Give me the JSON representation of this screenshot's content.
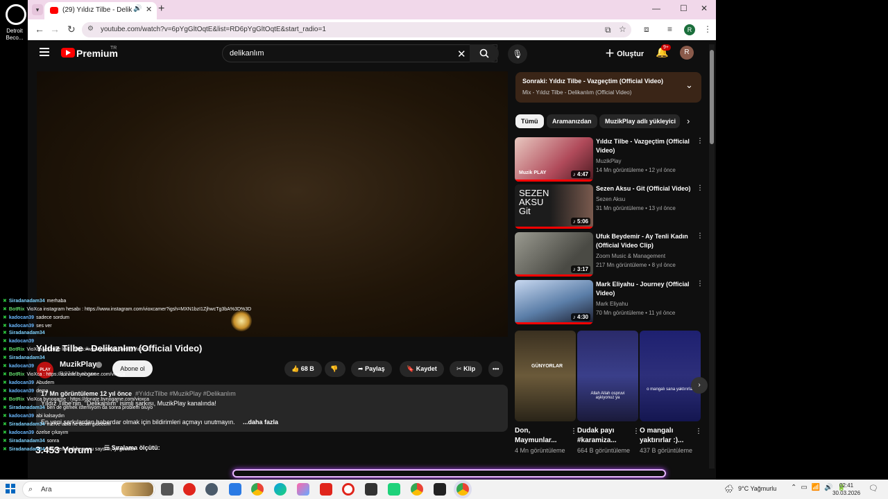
{
  "desktop": {
    "shortcut_label": "Detroit Beco..."
  },
  "browser": {
    "tab_count_title": "(29) Yıldız Tilbe - Delikanlım",
    "url": "youtube.com/watch?v=6pYgGltOqtE&list=RD6pYgGltOqtE&start_radio=1",
    "profile_initial": "R"
  },
  "yt": {
    "brand": "Premium",
    "tr": "TR",
    "search_value": "delikanlım",
    "create_label": "Oluştur",
    "notif_badge": "9+",
    "avatar_initial": "R"
  },
  "video": {
    "title": "Yıldız Tilbe - Delikanlım (Official Video)",
    "channel": "MuzikPlay",
    "channel_avatar_text": "PLAY",
    "subscribers": "5,27 Mn abone",
    "subscribe_label": "Abone ol",
    "likes": "68 B",
    "share_label": "Paylaş",
    "save_label": "Kaydet",
    "clip_label": "Klip",
    "more_label": "•••",
    "desc_meta": "17 Mn görüntüleme  12 yıl önce",
    "desc_tags": "#YıldızTilbe #MuzikPlay #Delikanlım",
    "desc_line1": "Yıldız Tilbe'nin, \"Delikanlım\" isimli şarkısı, MuzikPlay kanalında!",
    "desc_line2": "En yeni şarkılardan haberdar olmak için bildirimleri açmayı unutmayın.",
    "desc_more": "...daha fazla",
    "comments": "3.453 Yorum",
    "sort_label": "Sıralama ölçütü:"
  },
  "next_up": {
    "title": "Sonraki: Yıldız Tilbe - Vazgeçtim (Official Video)",
    "subtitle": "Mix - Yıldız Tilbe - Delikanlım (Official Video)"
  },
  "chips": [
    {
      "label": "Tümü"
    },
    {
      "label": "Aramanızdan"
    },
    {
      "label": "MuzikPlay adlı yükleyici"
    }
  ],
  "recommendations": [
    {
      "title": "Yıldız Tilbe - Vazgeçtim (Official Video)",
      "channel": "MuzikPlay",
      "meta": "14 Mn görüntüleme • 12 yıl önce",
      "duration": "♪ 4:47",
      "thumb_color": "#b04a5a",
      "thumb_text": "Muzik PLAY"
    },
    {
      "title": "Sezen Aksu - Git (Official Video)",
      "channel": "Sezen Aksu",
      "meta": "31 Mn görüntüleme • 13 yıl önce",
      "duration": "♪ 5:06",
      "thumb_color": "#2a2a2a",
      "thumb_text": "SEZEN AKSU Git"
    },
    {
      "title": "Ufuk Beydemir - Ay Tenli Kadın (Official Video Clip)",
      "channel": "Zoom Music & Management",
      "meta": "217 Mn görüntüleme • 8 yıl önce",
      "duration": "♪ 3:17",
      "thumb_color": "#6a6a62",
      "thumb_text": ""
    },
    {
      "title": "Mark Eliyahu - Journey (Official Video)",
      "channel": "Mark Eliyahu",
      "meta": "70 Mn görüntüleme • 11 yıl önce",
      "duration": "♪ 4:30",
      "thumb_color": "#5b7ea8",
      "thumb_text": ""
    }
  ],
  "shorts": [
    {
      "title": "Don, Maymunlar...",
      "views": "4 Mn görüntüleme",
      "caption": "GÜNYORLAR",
      "color": "#6b5a3a"
    },
    {
      "title": "Dudak payı #karamiza...",
      "views": "664 B görüntüleme",
      "caption": "Allah Allah ospruvi aşkiyonuz ya",
      "color": "#3a3f8a"
    },
    {
      "title": "O mangalı yaktırırlar :)...",
      "views": "437 B görüntüleme",
      "caption": "o mangalı sana yaktırırlar",
      "color": "#2d2f7a"
    }
  ],
  "chat": [
    {
      "user": "Siradanadam34",
      "msg": "merhaba",
      "color": "#7fd3ff"
    },
    {
      "user": "BotRix",
      "msg": "VioXca instagram hesabı : https://www.instagram.com/vioxcamer?igsh=MXN1bzI1ZjhwcTg3bA%3D%3D",
      "color": "#62d96b"
    },
    {
      "user": "kadocan39",
      "msg": "sadece sordum",
      "color": "#6ab8ff"
    },
    {
      "user": "kadocan39",
      "msg": "ses ver",
      "color": "#6ab8ff"
    },
    {
      "user": "Siradanadam34",
      "msg": "",
      "color": "#7fd3ff"
    },
    {
      "user": "kadocan39",
      "msg": "",
      "color": "#6ab8ff"
    },
    {
      "user": "BotRix",
      "msg": "VioXca youtube link : https://www.youtube.com/@VioXca",
      "color": "#62d96b"
    },
    {
      "user": "Siradanadam34",
      "msg": "",
      "color": "#7fd3ff"
    },
    {
      "user": "kadocan39",
      "msg": "",
      "color": "#6ab8ff"
    },
    {
      "user": "BotRix",
      "msg": "VioXca : https://donate.bynogame.com/vioxca",
      "color": "#62d96b"
    },
    {
      "user": "kadocan39",
      "msg": "Abudem",
      "color": "#6ab8ff"
    },
    {
      "user": "kadocan39",
      "msg": "dema",
      "color": "#6ab8ff"
    },
    {
      "user": "BotRix",
      "msg": "VioXca bynogame : https://donate.bynogame.com/vioxca",
      "color": "#62d96b"
    },
    {
      "user": "Siradanadam34",
      "msg": "ben de gitmek istemiyom da sonra problem oluyo",
      "color": "#7fd3ff"
    },
    {
      "user": "kadocan39",
      "msg": "abi kalsaydın",
      "color": "#6ab8ff"
    },
    {
      "user": "Siradanadam34",
      "msg": "merve abla he desin gidecem",
      "color": "#7fd3ff"
    },
    {
      "user": "kadocan39",
      "msg": "özelse çıkayım",
      "color": "#6ab8ff"
    },
    {
      "user": "Siradanadam34",
      "msg": "sonra",
      "color": "#7fd3ff"
    },
    {
      "user": "Siradanadam34",
      "msg": "okurken dedi ben onu saydım, iyi geceler",
      "color": "#7fd3ff"
    }
  ],
  "taskbar": {
    "search_placeholder": "Ara",
    "weather": "9°C  Yağmurlu",
    "time": "02:41",
    "date": "30.03.2026"
  }
}
